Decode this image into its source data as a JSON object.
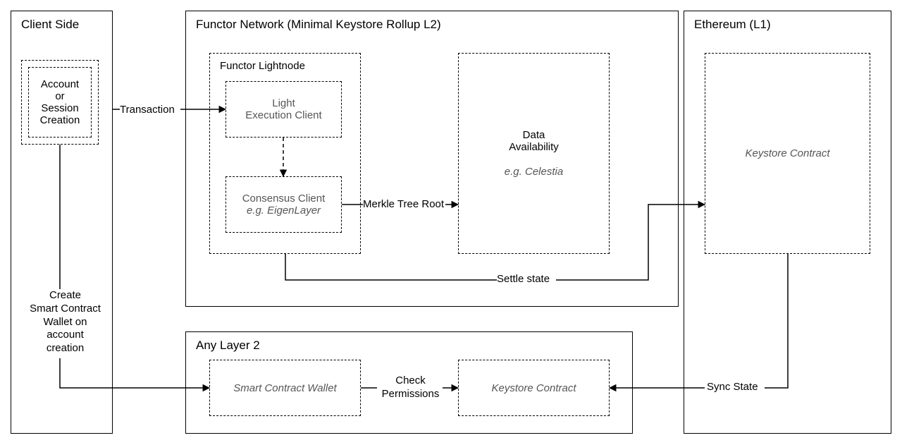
{
  "clientSide": {
    "title": "Client Side",
    "accountBox": {
      "line1": "Account",
      "line2": "or",
      "line3": "Session",
      "line4": "Creation"
    }
  },
  "functorNetwork": {
    "title": "Functor Network (Minimal Keystore Rollup L2)",
    "lightnode": {
      "title": "Functor Lightnode",
      "execClient": {
        "line1": "Light",
        "line2": "Execution Client"
      },
      "consensusClient": {
        "line1": "Consensus Client",
        "line2": "e.g. EigenLayer"
      }
    },
    "dataAvailability": {
      "line1": "Data",
      "line2": "Availability",
      "example": "e.g. Celestia"
    }
  },
  "ethereum": {
    "title": "Ethereum (L1)",
    "keystore": "Keystore Contract"
  },
  "anyLayer2": {
    "title": "Any Layer 2",
    "scw": "Smart Contract Wallet",
    "keystore": "Keystore Contract"
  },
  "edges": {
    "transaction": "Transaction",
    "merkleRoot": "Merkle Tree Root",
    "settleState": "Settle state",
    "createSCW": {
      "l1": "Create",
      "l2": "Smart Contract",
      "l3": "Wallet on",
      "l4": "account",
      "l5": "creation"
    },
    "checkPermissions": {
      "l1": "Check",
      "l2": "Permissions"
    },
    "syncState": "Sync State"
  }
}
